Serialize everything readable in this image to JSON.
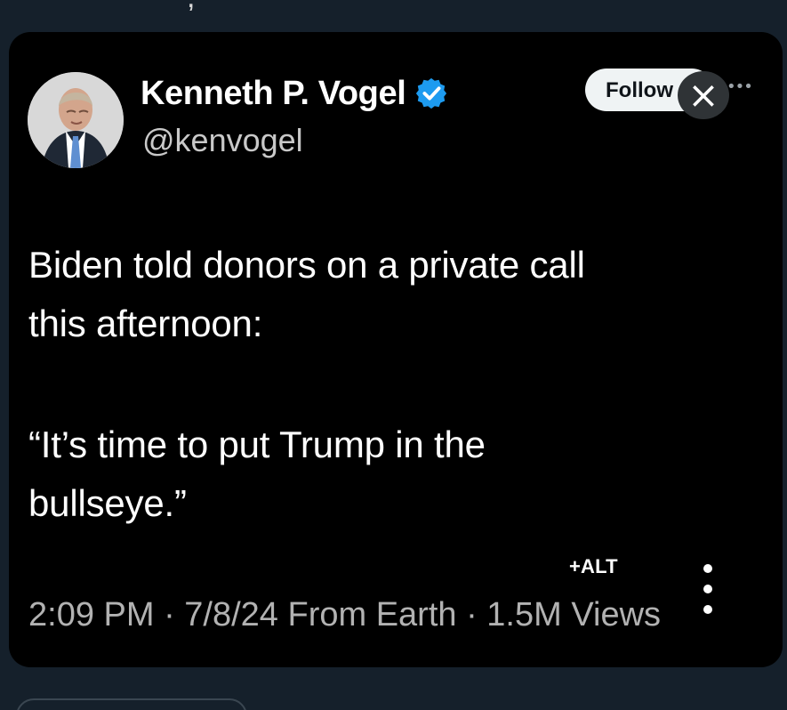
{
  "tweet": {
    "display_name": "Kenneth P. Vogel",
    "handle": "@kenvogel",
    "verified_icon": "verified-badge",
    "follow_label": "Follow",
    "close_label": "×",
    "text_lines": [
      "Biden told donors on a private call",
      "this afternoon:",
      "“It’s time to put Trump in the",
      "bullseye.”"
    ],
    "meta": "2:09 PM · 7/8/24 From Earth · 1.5M Views",
    "alt_label": "+ALT"
  },
  "colors": {
    "background": "#15202b",
    "card": "#000000",
    "verified": "#1d9bf0",
    "follow_button": "#eff3f4"
  }
}
